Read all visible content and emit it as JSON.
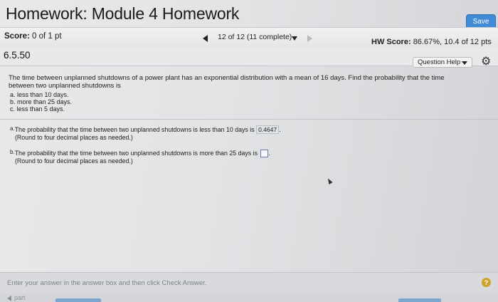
{
  "header": {
    "title": "Homework: Module 4 Homework",
    "save_label": "Save"
  },
  "score_bar": {
    "score_label": "Score:",
    "score_value": "0 of 1 pt",
    "nav_label": "12 of 12 (11 complete)",
    "hw_score_label": "HW Score:",
    "hw_score_value": "86.67%, 10.4 of 12 pts"
  },
  "question_bar": {
    "question_id": "6.5.50",
    "help_label": "Question Help"
  },
  "question": {
    "text": "The time between unplanned shutdowns of a power plant has an exponential distribution with a mean of 16 days. Find the probability that the time between two unplanned shutdowns is",
    "options": [
      "a.  less than 10 days.",
      "b.  more than 25 days.",
      "c.  less than 5 days."
    ]
  },
  "answers": {
    "a_tag": "a.",
    "a_text": "The probability that the time between two unplanned shutdowns is less than 10 days is",
    "a_value": "0.4647",
    "a_note": "(Round to four decimal places as needed.)",
    "b_tag": "b.",
    "b_text": "The probability that the time between two unplanned shutdowns is more than 25 days is",
    "b_value": "",
    "b_note": "(Round to four decimal places as needed.)"
  },
  "footer": {
    "instruction": "Enter your answer in the answer box and then click Check Answer.",
    "help_symbol": "?",
    "part_label": "part"
  },
  "colors": {
    "save_button": "#3f8bd6",
    "help_circle": "#d0a32a"
  },
  "icons": [
    "prev-arrow-icon",
    "dropdown-icon",
    "next-arrow-icon",
    "gear-icon",
    "help-icon",
    "mouse-cursor-icon"
  ]
}
